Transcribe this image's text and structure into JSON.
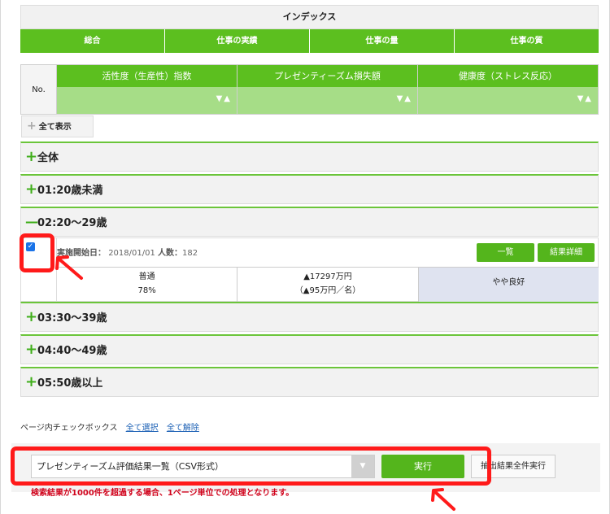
{
  "index": {
    "title": "インデックス",
    "tabs": [
      "総合",
      "仕事の実績",
      "仕事の量",
      "仕事の質"
    ]
  },
  "metrics": {
    "no_label": "No.",
    "columns": [
      "活性度（生産性）指数",
      "プレゼンティーズム損失額",
      "健康度（ストレス反応）"
    ],
    "sort_glyph": "▼▲"
  },
  "show_all_label": "全て表示",
  "groups": [
    {
      "label": "全体",
      "expanded": false
    },
    {
      "label": "01:20歳未満",
      "expanded": false
    },
    {
      "label": "02:20～29歳",
      "expanded": true
    },
    {
      "label": "03:30～39歳",
      "expanded": false
    },
    {
      "label": "04:40～49歳",
      "expanded": false
    },
    {
      "label": "05:50歳以上",
      "expanded": false
    }
  ],
  "detail": {
    "checked": true,
    "start_label": "実施開始日：",
    "start_value": "2018/01/01",
    "count_label": "人数：",
    "count_value": "182",
    "list_button": "一覧",
    "result_button": "結果詳細",
    "activity_level": "普通",
    "activity_pct": "78%",
    "loss_total": "▲17297万円",
    "loss_per": "（▲95万円／名）",
    "health": "やや良好"
  },
  "page_checkbox": {
    "label": "ページ内チェックボックス",
    "select_all": "全て選択",
    "clear_all": "全て解除"
  },
  "export": {
    "selected": "プレゼンティーズム評価結果一覧（CSV形式）",
    "run_button": "実行",
    "extract_button": "抽出結果全件実行",
    "warning": "検索結果が1000件を超過する場合、1ページ単位での処理となります。"
  },
  "colors": {
    "green": "#5cbf1f",
    "light_green": "#a6dd87",
    "highlight_red": "#ff1a1a"
  }
}
